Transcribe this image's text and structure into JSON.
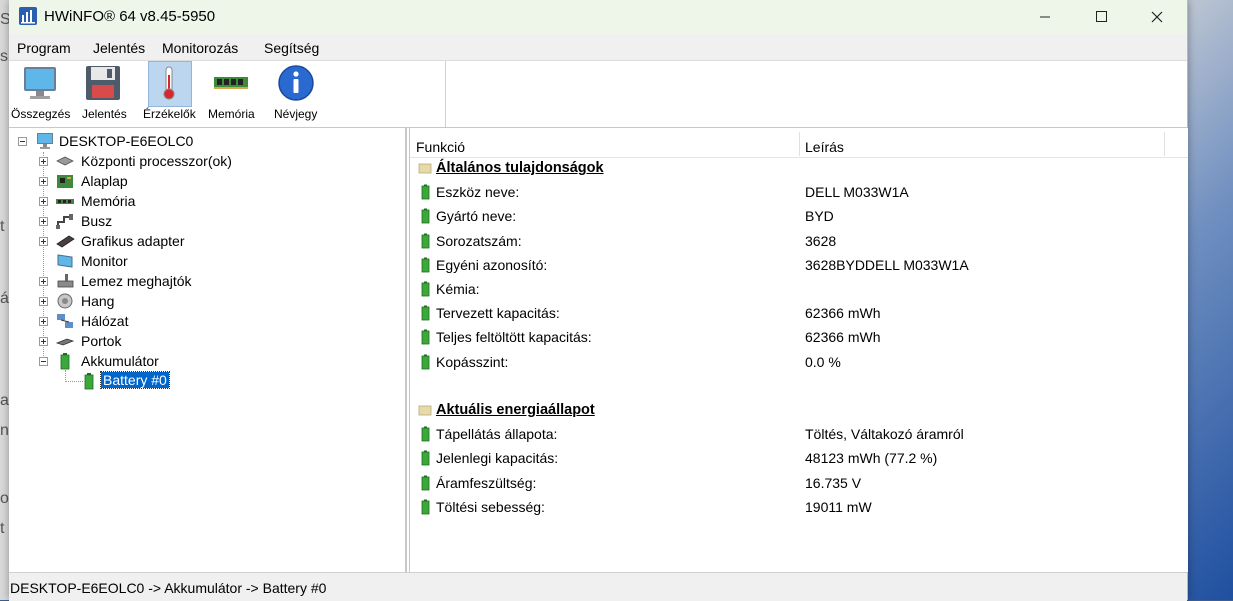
{
  "window": {
    "title": "HWiNFO® 64 v8.45-5950"
  },
  "menu": [
    "Program",
    "Jelentés",
    "Monitorozás",
    "Segítség"
  ],
  "toolbar": {
    "summary": "Összegzés",
    "report": "Jelentés",
    "sensors": "Érzékelők",
    "memory": "Memória",
    "about": "Névjegy"
  },
  "tree": {
    "root": "DESKTOP-E6EOLC0",
    "items": [
      "Központi processzor(ok)",
      "Alaplap",
      "Memória",
      "Busz",
      "Grafikus adapter",
      "Monitor",
      "Lemez meghajtók",
      "Hang",
      "Hálózat",
      "Portok",
      "Akkumulátor"
    ],
    "selected": "Battery #0"
  },
  "details": {
    "columns": {
      "function": "Funkció",
      "description": "Leírás"
    },
    "sections": [
      {
        "title": "Általános tulajdonságok",
        "rows": [
          {
            "label": "Eszköz neve:",
            "value": "DELL M033W1A"
          },
          {
            "label": "Gyártó neve:",
            "value": "BYD"
          },
          {
            "label": "Sorozatszám:",
            "value": "3628"
          },
          {
            "label": "Egyéni azonosító:",
            "value": "3628BYDDELL M033W1A"
          },
          {
            "label": "Kémia:",
            "value": ""
          },
          {
            "label": "Tervezett kapacitás:",
            "value": "62366 mWh"
          },
          {
            "label": "Teljes feltöltött kapacitás:",
            "value": "62366 mWh"
          },
          {
            "label": "Kopásszint:",
            "value": "0.0 %"
          }
        ]
      },
      {
        "title": "Aktuális energiaállapot",
        "rows": [
          {
            "label": "Tápellátás állapota:",
            "value": "Töltés, Váltakozó áramról"
          },
          {
            "label": "Jelenlegi kapacitás:",
            "value": "48123 mWh (77.2 %)"
          },
          {
            "label": "Áramfeszültség:",
            "value": "16.735 V"
          },
          {
            "label": "Töltési sebesség:",
            "value": "19011 mW"
          }
        ]
      }
    ]
  },
  "statusbar": {
    "path": "DESKTOP-E6EOLC0 -> Akkumulátor -> Battery #0"
  },
  "background_fragments": [
    "S",
    "s",
    "t",
    "á",
    "a",
    "n",
    "ok",
    "t"
  ],
  "colors": {
    "selection": "#0066cc",
    "titlebar": "#eef6ea",
    "battery_green": "#3aa83a"
  }
}
